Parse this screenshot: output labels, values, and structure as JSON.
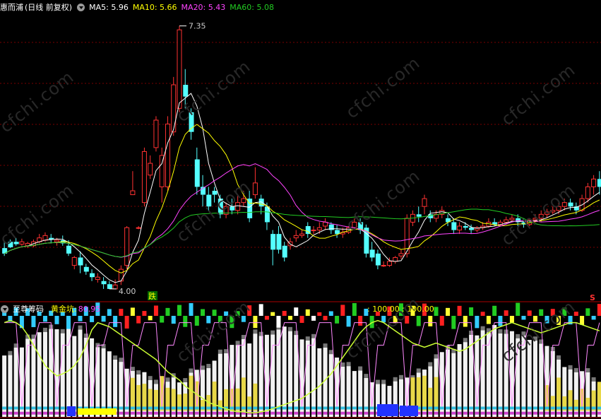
{
  "header": {
    "stock_name": "惠而浦",
    "chart_mode": "(日线 前复权)",
    "ma": [
      {
        "label": "MA5:",
        "value": "5.96",
        "color": "#ffffff"
      },
      {
        "label": "MA10:",
        "value": "5.66",
        "color": "#ffff00"
      },
      {
        "label": "MA20:",
        "value": "5.43",
        "color": "#ff44ff"
      },
      {
        "label": "MA60:",
        "value": "5.08",
        "color": "#22cc22"
      }
    ]
  },
  "annotations": {
    "high": "7.35",
    "low": "4.00",
    "fall_tag": "跌",
    "s_tag": "S"
  },
  "indicator": {
    "name": "至尊筹码",
    "gold_label": "黄金坑:",
    "gold_value": "80.95",
    "ref1": ": 100.00",
    "ref2": ": 100.00"
  },
  "watermark": "cfchi.com",
  "colors": {
    "bg": "#000000",
    "up": "#ff3232",
    "down": "#54ffff",
    "grid": "#7a0000",
    "name": "#ffffff",
    "gold_label": "#ffff00",
    "gold_value": "#ff44ff",
    "ref": "#ffff00"
  },
  "chart_data": {
    "type": "candlestick",
    "price_range": [
      3.9,
      7.5
    ],
    "x_count": 103,
    "candles": [
      [
        4.52,
        4.61,
        4.45,
        4.42
      ],
      [
        4.6,
        4.63,
        4.53,
        4.52
      ],
      [
        4.6,
        4.65,
        4.57,
        4.55
      ],
      [
        4.57,
        4.64,
        4.6,
        4.55
      ],
      [
        4.55,
        4.6,
        4.58,
        4.52
      ],
      [
        4.55,
        4.63,
        4.6,
        4.53
      ],
      [
        4.6,
        4.7,
        4.65,
        4.58
      ],
      [
        4.62,
        4.72,
        4.68,
        4.6
      ],
      [
        4.65,
        4.7,
        4.63,
        4.58
      ],
      [
        4.6,
        4.65,
        4.62,
        4.55
      ],
      [
        4.62,
        4.68,
        4.58,
        4.55
      ],
      [
        4.55,
        4.62,
        4.45,
        4.42
      ],
      [
        4.3,
        4.42,
        4.4,
        4.25
      ],
      [
        4.4,
        4.48,
        4.3,
        4.2
      ],
      [
        4.28,
        4.32,
        4.22,
        4.18
      ],
      [
        4.2,
        4.25,
        4.15,
        4.1
      ],
      [
        4.12,
        4.2,
        4.15,
        4.08
      ],
      [
        4.1,
        4.15,
        4.06,
        4.0
      ],
      [
        4.06,
        4.1,
        4.0,
        4.0
      ],
      [
        4.0,
        4.12,
        4.05,
        4.0
      ],
      [
        4.1,
        4.3,
        4.25,
        4.05
      ],
      [
        4.3,
        4.8,
        4.78,
        4.25
      ],
      [
        5.2,
        5.5,
        5.25,
        5.2
      ],
      [
        4.78,
        4.8,
        4.78,
        4.76
      ],
      [
        5.1,
        5.8,
        5.75,
        5.05
      ],
      [
        5.45,
        5.7,
        5.6,
        5.4
      ],
      [
        5.8,
        6.2,
        6.15,
        5.75
      ],
      [
        5.3,
        5.8,
        5.7,
        5.1
      ],
      [
        5.3,
        6.2,
        6.1,
        5.25
      ],
      [
        6.0,
        6.7,
        6.6,
        5.95
      ],
      [
        6.3,
        7.35,
        7.3,
        6.25
      ],
      [
        6.6,
        6.8,
        6.45,
        6.3
      ],
      [
        6.25,
        6.3,
        6.0,
        5.9
      ],
      [
        5.65,
        5.8,
        5.3,
        5.2
      ],
      [
        5.3,
        5.45,
        5.2,
        5.05
      ],
      [
        5.2,
        5.3,
        5.05,
        5.0
      ],
      [
        5.25,
        5.3,
        5.2,
        5.1
      ],
      [
        5.15,
        5.2,
        4.95,
        4.9
      ],
      [
        4.95,
        5.1,
        5.05,
        4.9
      ],
      [
        5.05,
        5.15,
        5.0,
        4.95
      ],
      [
        5.0,
        5.2,
        5.1,
        4.95
      ],
      [
        5.1,
        5.25,
        5.15,
        5.05
      ],
      [
        5.15,
        5.25,
        4.9,
        4.85
      ],
      [
        5.2,
        5.55,
        5.35,
        5.15
      ],
      [
        5.15,
        5.2,
        5.05,
        4.95
      ],
      [
        5.05,
        5.1,
        4.85,
        4.75
      ],
      [
        4.7,
        4.75,
        4.5,
        4.3
      ],
      [
        4.7,
        4.8,
        4.5,
        4.45
      ],
      [
        4.55,
        4.6,
        4.4,
        4.35
      ],
      [
        4.55,
        4.65,
        4.6,
        4.5
      ],
      [
        4.65,
        4.75,
        4.68,
        4.6
      ],
      [
        4.68,
        4.75,
        4.7,
        4.65
      ],
      [
        4.8,
        4.85,
        4.7,
        4.65
      ],
      [
        4.75,
        4.8,
        4.75,
        4.7
      ],
      [
        4.75,
        4.85,
        4.78,
        4.7
      ],
      [
        4.8,
        4.9,
        4.85,
        4.75
      ],
      [
        4.82,
        4.85,
        4.75,
        4.7
      ],
      [
        4.75,
        4.82,
        4.7,
        4.65
      ],
      [
        4.7,
        4.78,
        4.72,
        4.65
      ],
      [
        4.72,
        4.8,
        4.78,
        4.7
      ],
      [
        4.78,
        4.9,
        4.85,
        4.75
      ],
      [
        4.85,
        4.9,
        4.75,
        4.7
      ],
      [
        4.78,
        4.82,
        4.45,
        4.4
      ],
      [
        4.5,
        4.6,
        4.4,
        4.35
      ],
      [
        4.45,
        4.5,
        4.3,
        4.25
      ],
      [
        4.3,
        4.35,
        4.3,
        4.28
      ],
      [
        4.3,
        4.4,
        4.35,
        4.28
      ],
      [
        4.35,
        4.42,
        4.4,
        4.32
      ],
      [
        4.42,
        4.5,
        4.45,
        4.38
      ],
      [
        4.45,
        4.95,
        4.9,
        4.4
      ],
      [
        4.85,
        5.0,
        4.95,
        4.8
      ],
      [
        4.95,
        5.05,
        4.92,
        4.85
      ],
      [
        5.05,
        5.2,
        5.15,
        4.95
      ],
      [
        4.95,
        5.0,
        4.9,
        4.85
      ],
      [
        4.9,
        5.0,
        4.95,
        4.85
      ],
      [
        4.95,
        5.05,
        5.0,
        4.9
      ],
      [
        4.9,
        4.95,
        4.85,
        4.8
      ],
      [
        4.85,
        4.9,
        4.75,
        4.7
      ],
      [
        4.75,
        4.85,
        4.8,
        4.7
      ],
      [
        4.8,
        4.85,
        4.78,
        4.75
      ],
      [
        4.78,
        4.82,
        4.75,
        4.7
      ],
      [
        4.75,
        4.8,
        4.78,
        4.72
      ],
      [
        4.78,
        4.85,
        4.8,
        4.75
      ],
      [
        4.8,
        4.9,
        4.85,
        4.78
      ],
      [
        4.85,
        4.9,
        4.82,
        4.8
      ],
      [
        4.82,
        4.88,
        4.85,
        4.8
      ],
      [
        4.85,
        4.92,
        4.88,
        4.82
      ],
      [
        4.88,
        4.95,
        4.9,
        4.85
      ],
      [
        4.9,
        4.95,
        4.85,
        4.8
      ],
      [
        4.85,
        4.9,
        4.82,
        4.78
      ],
      [
        4.82,
        4.9,
        4.88,
        4.8
      ],
      [
        4.88,
        4.95,
        4.9,
        4.85
      ],
      [
        4.9,
        5.0,
        4.95,
        4.85
      ],
      [
        4.95,
        5.02,
        4.98,
        4.9
      ],
      [
        4.98,
        5.05,
        5.0,
        4.95
      ],
      [
        5.0,
        5.1,
        5.05,
        4.95
      ],
      [
        5.05,
        5.15,
        5.1,
        5.0
      ],
      [
        5.1,
        5.15,
        5.05,
        5.0
      ],
      [
        5.05,
        5.1,
        5.0,
        4.95
      ],
      [
        5.0,
        5.2,
        5.15,
        4.98
      ],
      [
        5.15,
        5.35,
        5.3,
        5.1
      ],
      [
        5.3,
        5.45,
        5.4,
        5.2
      ],
      [
        5.4,
        5.5,
        5.3,
        5.2
      ]
    ]
  }
}
